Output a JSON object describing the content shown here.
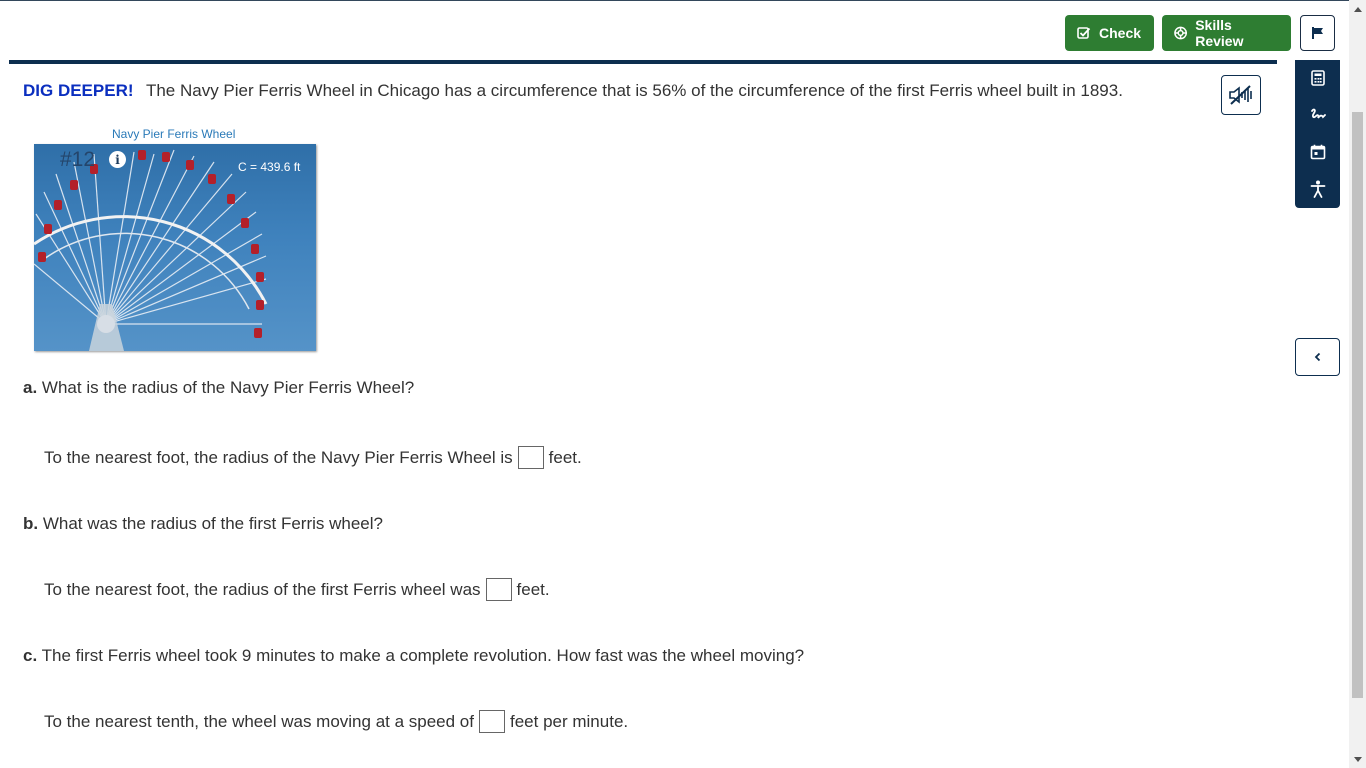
{
  "toolbar": {
    "check_label": "Check",
    "skills_review_label": "Skills Review",
    "check_icon": "check-square-icon",
    "skills_icon": "lifebuoy-icon",
    "flag_icon": "flag-icon"
  },
  "colors": {
    "primary_green": "#2e7d32",
    "navy": "#0d2e4f",
    "dig_deeper_blue": "#0b2fbf",
    "caption_blue": "#2a7ab8"
  },
  "tool_rail": {
    "items": [
      "calculator-icon",
      "scribble-icon",
      "calendar-icon",
      "accessibility-icon"
    ]
  },
  "problem": {
    "tag": "DIG DEEPER!",
    "intro": "The Navy Pier Ferris Wheel in Chicago has a circumference that is 56% of the circumference of the first Ferris wheel built in 1893.",
    "audio_icon": "audio-off-icon"
  },
  "figure": {
    "caption": "Navy Pier Ferris Wheel",
    "number": "#12",
    "info_glyph": "i",
    "circumference_label": "C = 439.6 ft"
  },
  "parts": [
    {
      "letter": "a.",
      "question": "What is the radius of the Navy Pier Ferris Wheel?",
      "answer_before": "To the nearest foot, the radius of the Navy Pier Ferris Wheel is",
      "answer_after": "feet.",
      "value": ""
    },
    {
      "letter": "b.",
      "question": "What was the radius of the first Ferris wheel?",
      "answer_before": "To the nearest foot, the radius of the first Ferris wheel was",
      "answer_after": "feet.",
      "value": ""
    },
    {
      "letter": "c.",
      "question": "The first Ferris wheel took 9 minutes to make a complete revolution. How fast was the wheel moving?",
      "answer_before": "To the nearest tenth, the wheel was moving at a speed of",
      "answer_after": "feet per minute.",
      "value": ""
    }
  ]
}
